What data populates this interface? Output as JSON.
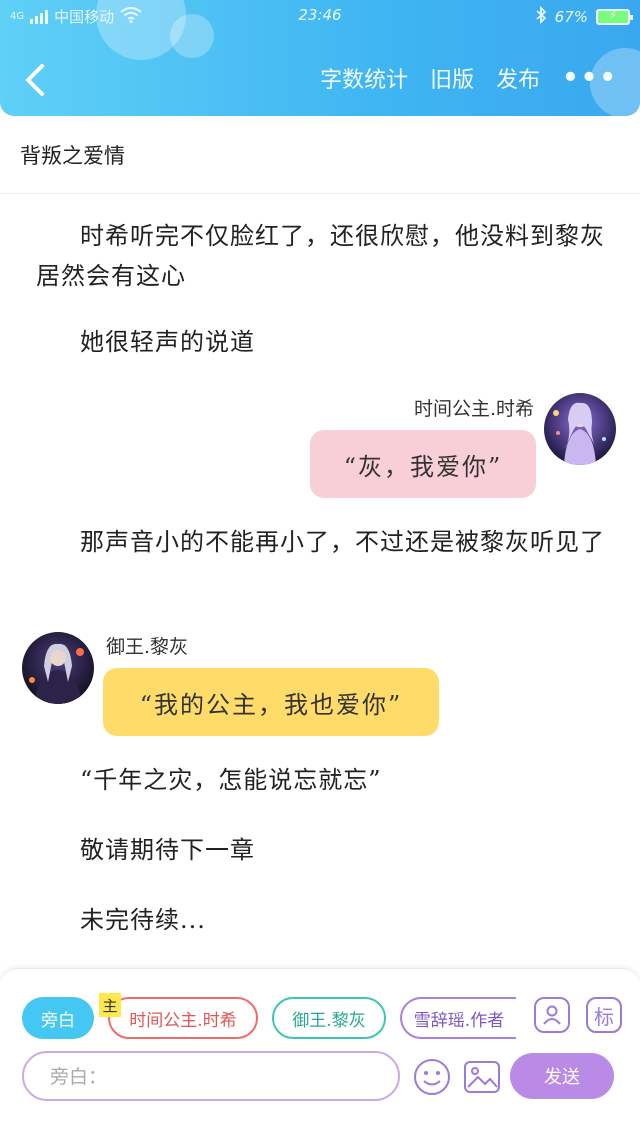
{
  "status_bar": {
    "network": "4G",
    "carrier": "中国移动",
    "time": "23:46",
    "battery": "67%",
    "icons": [
      "signal-icon",
      "wifi-icon",
      "bluetooth-icon",
      "battery-icon"
    ]
  },
  "nav": {
    "back_icon": "chevron-left-icon",
    "word_count": "字数统计",
    "old_version": "旧版",
    "publish": "发布",
    "more": "•••"
  },
  "story": {
    "title": "背叛之爱情"
  },
  "content": {
    "para1": "时希听完不仅脸红了，还很欣慰，他没料到黎灰居然会有这心",
    "para2": "她很轻声的说道",
    "chat1": {
      "speaker": "时间公主.时希",
      "text": "“灰，我爱你”",
      "color": "#f8cfd7"
    },
    "para3": "那声音小的不能再小了，不过还是被黎灰听见了",
    "chat2": {
      "speaker": "御王.黎灰",
      "text": "“我的公主，我也爱你”",
      "color": "#ffdc6a"
    },
    "para4": "“千年之灾，怎能说忘就忘”",
    "para5": "敬请期待下一章",
    "para6": "未完待续..."
  },
  "composer": {
    "chips": {
      "narrator": "旁白",
      "main_tag": "主",
      "shixi": "时间公主.时希",
      "lihui": "御王.黎灰",
      "author": "雪辞瑶.作者"
    },
    "role_icon": "person-card-icon",
    "tag_label": "标",
    "placeholder": "旁白：",
    "emoji_icon": "smiley-icon",
    "image_icon": "image-icon",
    "send": "发送"
  }
}
